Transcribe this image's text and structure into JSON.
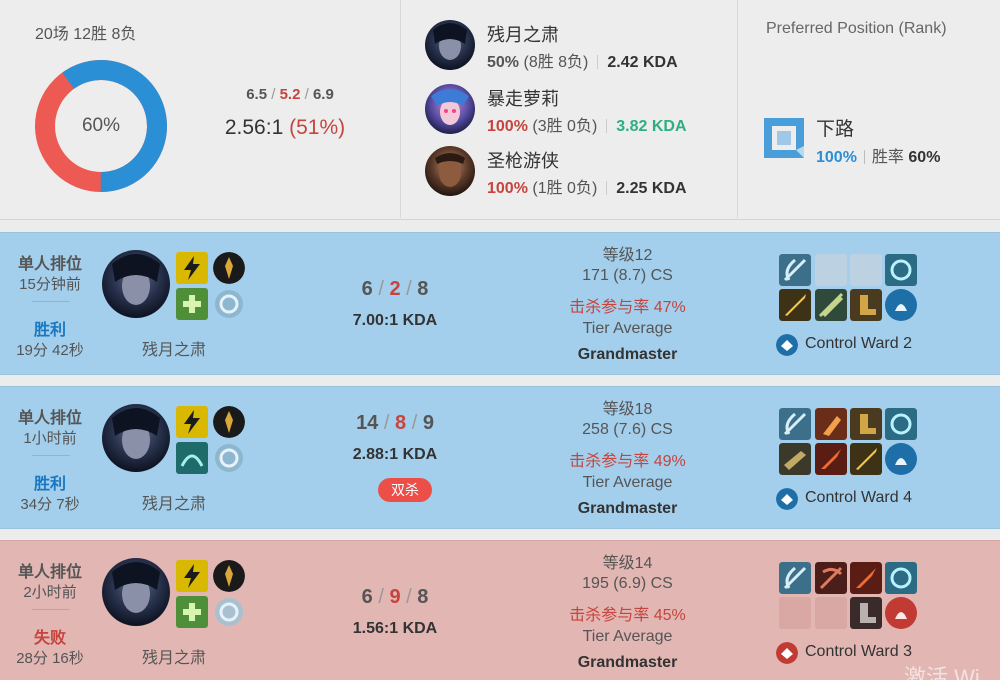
{
  "summary": {
    "record": "20场 12胜 8负",
    "win_rate": "60%",
    "win_fraction": 0.6,
    "avg_kills": "6.5",
    "avg_deaths": "5.2",
    "avg_assists": "6.9",
    "kda_ratio": "2.56:1",
    "kp": "(51%)",
    "colors": {
      "win": "#2b8fd6",
      "loss": "#ec5a53"
    }
  },
  "champions": [
    {
      "name": "残月之肃",
      "win_rate": "50%",
      "record": "(8胜 8负)",
      "kda": "2.42 KDA",
      "hot": false,
      "kda_green": false
    },
    {
      "name": "暴走萝莉",
      "win_rate": "100%",
      "record": "(3胜 0负)",
      "kda": "3.82 KDA",
      "hot": true,
      "kda_green": true
    },
    {
      "name": "圣枪游侠",
      "win_rate": "100%",
      "record": "(1胜 0负)",
      "kda": "2.25 KDA",
      "hot": true,
      "kda_green": false
    }
  ],
  "position": {
    "title": "Preferred Position (Rank)",
    "name": "下路",
    "share": "100%",
    "win_label": "胜率",
    "win_rate": "60%"
  },
  "matches": [
    {
      "queue": "单人排位",
      "time_ago": "15分钟前",
      "result": "胜利",
      "duration": "19分 42秒",
      "champion": "残月之肃",
      "kills": "6",
      "deaths": "2",
      "assists": "8",
      "kda": "7.00:1 KDA",
      "badge": "",
      "level": "等级12",
      "cs": "171 (8.7) CS",
      "kp": "击杀参与率 47%",
      "tier_label": "Tier Average",
      "tier": "Grandmaster",
      "ward": "Control Ward 2"
    },
    {
      "queue": "单人排位",
      "time_ago": "1小时前",
      "result": "胜利",
      "duration": "34分 7秒",
      "champion": "残月之肃",
      "kills": "14",
      "deaths": "8",
      "assists": "9",
      "kda": "2.88:1 KDA",
      "badge": "双杀",
      "level": "等级18",
      "cs": "258 (7.6) CS",
      "kp": "击杀参与率 49%",
      "tier_label": "Tier Average",
      "tier": "Grandmaster",
      "ward": "Control Ward 4"
    },
    {
      "queue": "单人排位",
      "time_ago": "2小时前",
      "result": "失败",
      "duration": "28分 16秒",
      "champion": "残月之肃",
      "kills": "6",
      "deaths": "9",
      "assists": "8",
      "kda": "1.56:1 KDA",
      "badge": "",
      "level": "等级14",
      "cs": "195 (6.9) CS",
      "kp": "击杀参与率 45%",
      "tier_label": "Tier Average",
      "tier": "Grandmaster",
      "ward": "Control Ward 3"
    }
  ],
  "watermark": "激活 Wi"
}
